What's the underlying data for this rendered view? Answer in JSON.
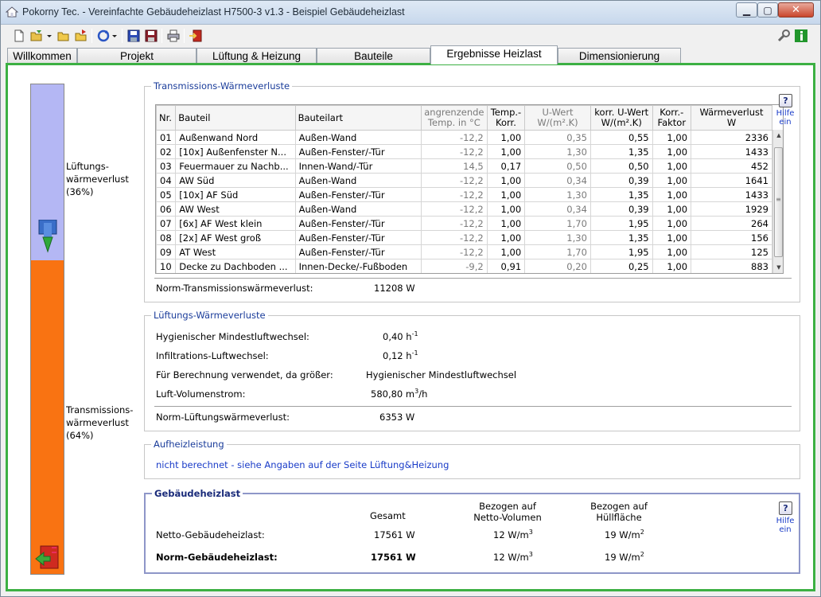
{
  "window": {
    "title": "Pokorny Tec.  -  Vereinfachte Gebäudeheizlast H7500-3 v1.3  -  Beispiel Gebäudeheizlast",
    "min_glyph": "▁",
    "max_glyph": "▢",
    "close_glyph": "✕"
  },
  "tabs": [
    {
      "label": "Willkommen"
    },
    {
      "label": "Projekt"
    },
    {
      "label": "Lüftung & Heizung"
    },
    {
      "label": "Bauteile"
    },
    {
      "label": "Ergebnisse Heizlast"
    },
    {
      "label": "Dimensionierung"
    }
  ],
  "ratio": {
    "ventilation_label_1": "Lüftungs-",
    "ventilation_label_2": "wärmeverlust",
    "ventilation_label_3": "(36%)",
    "ventilation_share": 0.36,
    "transmission_label_1": "Transmissions-",
    "transmission_label_2": "wärmeverlust",
    "transmission_label_3": "(64%)",
    "transmission_share": 0.64
  },
  "transmission": {
    "group_title": "Transmissions-Wärmeverluste",
    "columns": {
      "nr": "Nr.",
      "bauteil": "Bauteil",
      "art": "Bauteilart",
      "temp_1": "angrenzende",
      "temp_2": "Temp. in °C",
      "korr_1": "Temp.-",
      "korr_2": "Korr.",
      "u_1": "U-Wert",
      "u_2": "W/(m².K)",
      "ku_1": "korr. U-Wert",
      "ku_2": "W/(m².K)",
      "kf_1": "Korr.-",
      "kf_2": "Faktor",
      "wv_1": "Wärmeverlust",
      "wv_2": "W"
    },
    "rows": [
      {
        "nr": "01",
        "bauteil": "Außenwand Nord",
        "art": "Außen-Wand",
        "temp": "-12,2",
        "korr": "1,00",
        "u": "0,35",
        "ku": "0,55",
        "kf": "1,00",
        "wv": "2336"
      },
      {
        "nr": "02",
        "bauteil": "[10x] Außenfenster N...",
        "art": "Außen-Fenster/-Tür",
        "temp": "-12,2",
        "korr": "1,00",
        "u": "1,30",
        "ku": "1,35",
        "kf": "1,00",
        "wv": "1433"
      },
      {
        "nr": "03",
        "bauteil": "Feuermauer zu Nachb...",
        "art": "Innen-Wand/-Tür",
        "temp": "14,5",
        "korr": "0,17",
        "u": "0,50",
        "ku": "0,50",
        "kf": "1,00",
        "wv": "452"
      },
      {
        "nr": "04",
        "bauteil": "AW Süd",
        "art": "Außen-Wand",
        "temp": "-12,2",
        "korr": "1,00",
        "u": "0,34",
        "ku": "0,39",
        "kf": "1,00",
        "wv": "1641"
      },
      {
        "nr": "05",
        "bauteil": "[10x] AF Süd",
        "art": "Außen-Fenster/-Tür",
        "temp": "-12,2",
        "korr": "1,00",
        "u": "1,30",
        "ku": "1,35",
        "kf": "1,00",
        "wv": "1433"
      },
      {
        "nr": "06",
        "bauteil": "AW West",
        "art": "Außen-Wand",
        "temp": "-12,2",
        "korr": "1,00",
        "u": "0,34",
        "ku": "0,39",
        "kf": "1,00",
        "wv": "1929"
      },
      {
        "nr": "07",
        "bauteil": "[6x] AF West klein",
        "art": "Außen-Fenster/-Tür",
        "temp": "-12,2",
        "korr": "1,00",
        "u": "1,70",
        "ku": "1,95",
        "kf": "1,00",
        "wv": "264"
      },
      {
        "nr": "08",
        "bauteil": "[2x] AF West groß",
        "art": "Außen-Fenster/-Tür",
        "temp": "-12,2",
        "korr": "1,00",
        "u": "1,30",
        "ku": "1,35",
        "kf": "1,00",
        "wv": "156"
      },
      {
        "nr": "09",
        "bauteil": "AT West",
        "art": "Außen-Fenster/-Tür",
        "temp": "-12,2",
        "korr": "1,00",
        "u": "1,70",
        "ku": "1,95",
        "kf": "1,00",
        "wv": "125"
      },
      {
        "nr": "10",
        "bauteil": "Decke zu Dachboden ...",
        "art": "Innen-Decke/-Fußboden",
        "temp": "-9,2",
        "korr": "0,91",
        "u": "0,20",
        "ku": "0,25",
        "kf": "1,00",
        "wv": "883"
      }
    ],
    "total_label": "Norm-Transmissionswärmeverlust:",
    "total_value": "11208 W",
    "help_label_1": "Hilfe",
    "help_label_2": "ein",
    "help_glyph": "?",
    "scroll_up": "▲",
    "scroll_down": "▼",
    "scroll_grip": "≡"
  },
  "ventilation": {
    "group_title": "Lüftungs-Wärmeverluste",
    "hygienic_label": "Hygienischer Mindestluftwechsel:",
    "hygienic_value": "0,40 h",
    "hygienic_exp": "-1",
    "infiltration_label": "Infiltrations-Luftwechsel:",
    "infiltration_value": "0,12 h",
    "infiltration_exp": "-1",
    "used_label": "Für Berechnung verwendet, da größer:",
    "used_value": "Hygienischer Mindestluftwechsel",
    "volume_label": "Luft-Volumenstrom:",
    "volume_value": "580,80 m",
    "volume_exp": "3",
    "volume_unit": "/h",
    "total_label": "Norm-Lüftungswärmeverlust:",
    "total_value": "6353 W"
  },
  "heating": {
    "group_title": "Aufheizleistung",
    "text_link": "nicht berechnet",
    "text_rest": " - siehe Angaben auf der Seite Lüftung&Heizung"
  },
  "building": {
    "group_title": "Gebäudeheizlast",
    "col_total": "Gesamt",
    "col_volume_1": "Bezogen auf",
    "col_volume_2": "Netto-Volumen",
    "col_area_1": "Bezogen auf",
    "col_area_2": "Hüllfläche",
    "netto_label": "Netto-Gebäudeheizlast:",
    "netto_total": "17561 W",
    "netto_volume": "12 W/m",
    "netto_volume_exp": "3",
    "netto_area": "19 W/m",
    "netto_area_exp": "2",
    "norm_label": "Norm-Gebäudeheizlast:",
    "norm_total": "17561 W",
    "norm_volume": "12 W/m",
    "norm_volume_exp": "3",
    "norm_area": "19 W/m",
    "norm_area_exp": "2",
    "help_label_1": "Hilfe",
    "help_label_2": "ein",
    "help_glyph": "?"
  },
  "colors": {
    "ventilation": "#b4b7f4",
    "transmission": "#f97312",
    "frame": "#3cb043"
  }
}
